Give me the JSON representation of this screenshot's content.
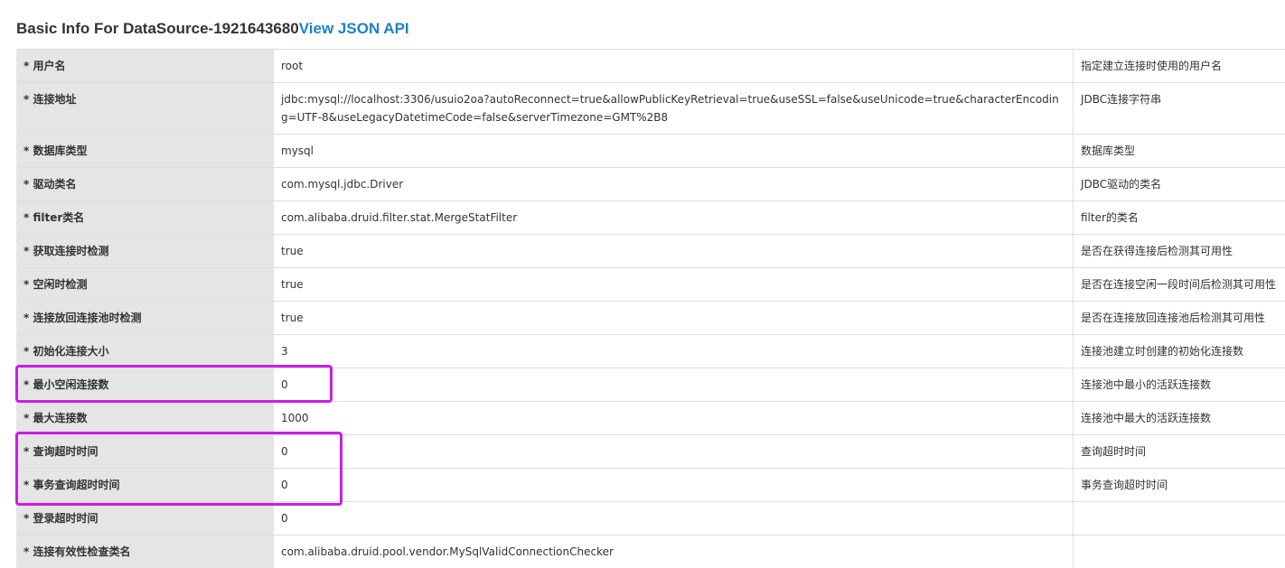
{
  "header": {
    "title": "Basic Info For DataSource-1921643680",
    "api_link": "View JSON API"
  },
  "rows": [
    {
      "label": "* 用户名",
      "value": "root",
      "desc": "指定建立连接时使用的用户名"
    },
    {
      "label": "* 连接地址",
      "value": "jdbc:mysql://localhost:3306/usuio2oa?autoReconnect=true&allowPublicKeyRetrieval=true&useSSL=false&useUnicode=true&characterEncoding=UTF-8&useLegacyDatetimeCode=false&serverTimezone=GMT%2B8",
      "desc": "JDBC连接字符串"
    },
    {
      "label": "* 数据库类型",
      "value": "mysql",
      "desc": "数据库类型"
    },
    {
      "label": "* 驱动类名",
      "value": "com.mysql.jdbc.Driver",
      "desc": "JDBC驱动的类名"
    },
    {
      "label": "* filter类名",
      "value": "com.alibaba.druid.filter.stat.MergeStatFilter",
      "desc": "filter的类名"
    },
    {
      "label": "* 获取连接时检测",
      "value": "true",
      "desc": "是否在获得连接后检测其可用性"
    },
    {
      "label": "* 空闲时检测",
      "value": "true",
      "desc": "是否在连接空闲一段时间后检测其可用性"
    },
    {
      "label": "* 连接放回连接池时检测",
      "value": "true",
      "desc": "是否在连接放回连接池后检测其可用性"
    },
    {
      "label": "* 初始化连接大小",
      "value": "3",
      "desc": "连接池建立时创建的初始化连接数"
    },
    {
      "label": "* 最小空闲连接数",
      "value": "0",
      "desc": "连接池中最小的活跃连接数"
    },
    {
      "label": "* 最大连接数",
      "value": "1000",
      "desc": "连接池中最大的活跃连接数"
    },
    {
      "label": "* 查询超时时间",
      "value": "0",
      "desc": "查询超时时间"
    },
    {
      "label": "* 事务查询超时时间",
      "value": "0",
      "desc": "事务查询超时时间"
    },
    {
      "label": "* 登录超时时间",
      "value": "0",
      "desc": ""
    },
    {
      "label": "* 连接有效性检查类名",
      "value": "com.alibaba.druid.pool.vendor.MySqlValidConnectionChecker",
      "desc": ""
    }
  ],
  "annotation_color": "#c81ee6"
}
